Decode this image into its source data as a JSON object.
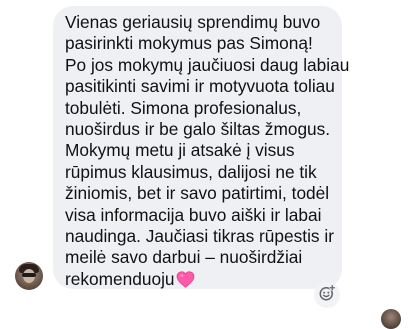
{
  "message": {
    "lines": [
      "Vienas geriausių sprendimų buvo",
      "pasirinkti mokymus pas Simoną!",
      "Po jos mokymų jaučiuosi daug labiau",
      "pasitikinti savimi ir motyvuota toliau",
      "tobulėti. Simona profesionalus,",
      "nuoširdus ir be galo šiltas žmogus.",
      "Mokymų metu ji atsakė į visus",
      "rūpimus klausimus, dalijosi ne tik",
      "žiniomis, bet ir savo patirtimi, todėl",
      "visa informacija buvo aiški ir labai",
      "naudinga. Jaučiasi tikras rūpestis ir",
      "meilė savo darbui – nuoširdžiai",
      "rekomenduoju"
    ],
    "emoji": "pink-heart-icon"
  },
  "colors": {
    "bubble_bg": "#eff0f3",
    "text": "#111111",
    "heart": "#ff5aa8",
    "react_icon": "#65676b"
  },
  "icons": {
    "sender_avatar": "avatar",
    "react": "add-reaction-icon",
    "corner": "avatar"
  }
}
